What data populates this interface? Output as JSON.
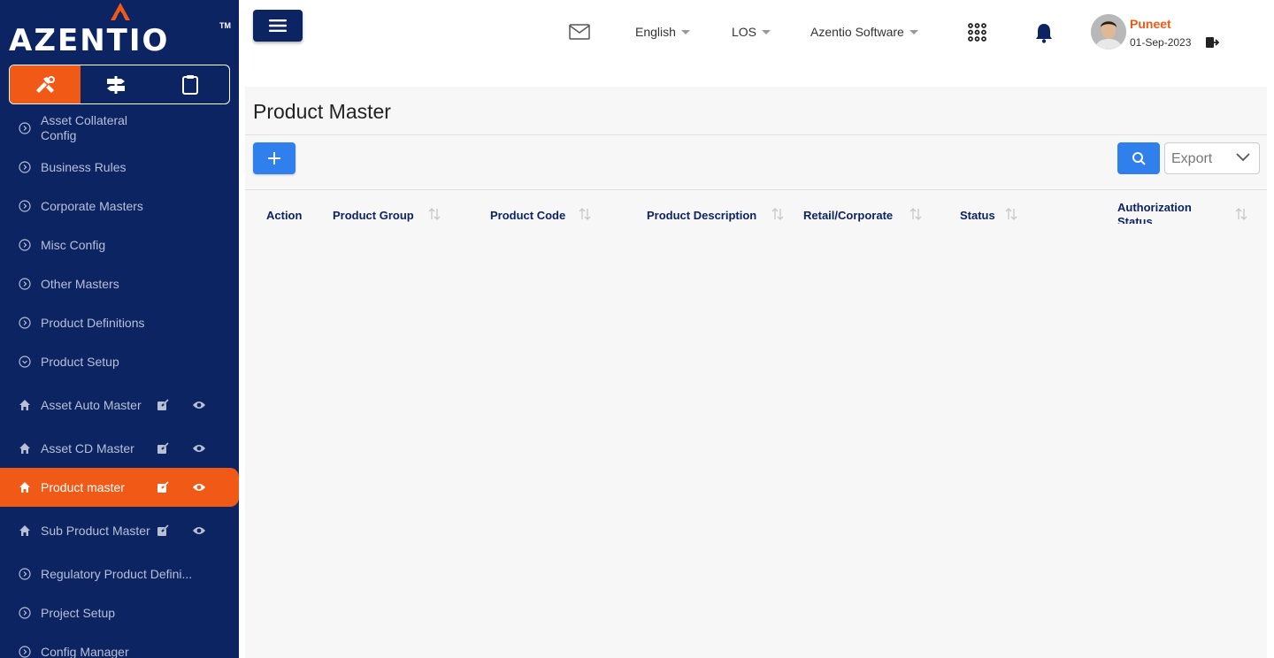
{
  "brand": {
    "logo_text": "AZENTIO",
    "tm": "TM"
  },
  "module_tabs": [
    {
      "icon": "tools-icon",
      "active": true
    },
    {
      "icon": "signpost-icon",
      "active": false
    },
    {
      "icon": "clipboard-icon",
      "active": false
    }
  ],
  "sidebar": {
    "items": [
      {
        "label": "Asset Collateral Config",
        "icon": "chevron-circle-right-icon"
      },
      {
        "label": "Business Rules",
        "icon": "chevron-circle-right-icon"
      },
      {
        "label": "Corporate Masters",
        "icon": "chevron-circle-right-icon"
      },
      {
        "label": "Misc Config",
        "icon": "chevron-circle-right-icon"
      },
      {
        "label": "Other Masters",
        "icon": "chevron-circle-right-icon"
      },
      {
        "label": "Product Definitions",
        "icon": "chevron-circle-right-icon"
      },
      {
        "label": "Product Setup",
        "icon": "chevron-circle-down-icon"
      },
      {
        "label": "Asset Auto Master",
        "icon": "home-icon",
        "actions": [
          "edit-icon",
          "eye-icon"
        ]
      },
      {
        "label": "Asset CD Master",
        "icon": "home-icon",
        "actions": [
          "edit-icon",
          "eye-icon"
        ]
      },
      {
        "label": "Product master",
        "icon": "home-icon",
        "actions": [
          "edit-icon",
          "eye-icon"
        ],
        "active": true
      },
      {
        "label": "Sub Product Master",
        "icon": "home-icon",
        "actions": [
          "edit-icon",
          "eye-icon"
        ]
      },
      {
        "label": "Regulatory Product Defini...",
        "icon": "chevron-circle-right-icon"
      },
      {
        "label": "Project Setup",
        "icon": "chevron-circle-right-icon"
      },
      {
        "label": "Config Manager",
        "icon": "chevron-circle-right-icon"
      }
    ]
  },
  "header": {
    "language": "English",
    "module": "LOS",
    "company": "Azentio Software",
    "user": {
      "name": "Puneet",
      "date": "01-Sep-2023"
    }
  },
  "main": {
    "title": "Product Master",
    "export_label": "Export",
    "columns": [
      {
        "label": "Action",
        "sortable": false
      },
      {
        "label": "Product Group",
        "sortable": true
      },
      {
        "label": "Product Code",
        "sortable": true
      },
      {
        "label": "Product Description",
        "sortable": true
      },
      {
        "label": "Retail/Corporate",
        "sortable": true
      },
      {
        "label": "Status",
        "sortable": true
      },
      {
        "label": "Authorization Status",
        "sortable": true
      }
    ]
  },
  "colors": {
    "sidebar_bg": "#0d2463",
    "accent": "#f05a16",
    "primary_button": "#2f80ed"
  }
}
